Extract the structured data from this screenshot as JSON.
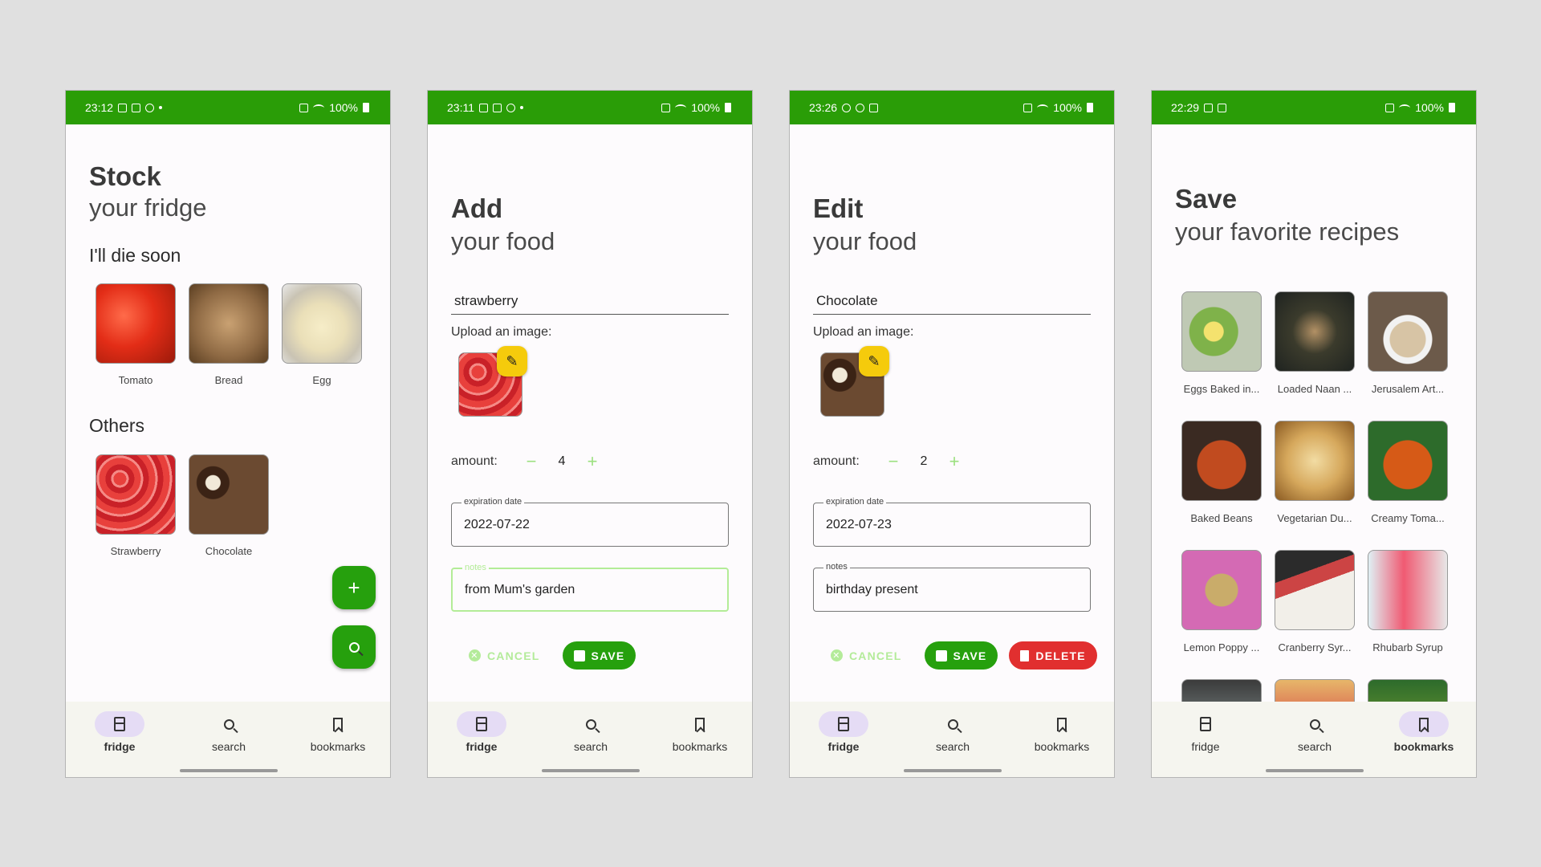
{
  "colors": {
    "primary": "#26a00d",
    "status_bar": "#2a9d07",
    "edit_badge": "#f5cb0c",
    "delete": "#e12f2f",
    "cancel": "#b4eb9a"
  },
  "nav": {
    "fridge": "fridge",
    "search": "search",
    "bookmarks": "bookmarks"
  },
  "screens": [
    {
      "status": {
        "time": "23:12",
        "battery": "100%"
      },
      "title_bold": "Stock",
      "title_light": "your fridge",
      "sections": [
        {
          "title": "I'll die soon",
          "items": [
            {
              "label": "Tomato",
              "image": "tomato"
            },
            {
              "label": "Bread",
              "image": "bread"
            },
            {
              "label": "Egg",
              "image": "egg"
            }
          ]
        },
        {
          "title": "Others",
          "items": [
            {
              "label": "Strawberry",
              "image": "strawberry"
            },
            {
              "label": "Chocolate",
              "image": "chocolate"
            }
          ]
        }
      ],
      "fabs": {
        "add": "+",
        "search": "search-icon"
      }
    },
    {
      "status": {
        "time": "23:11",
        "battery": "100%"
      },
      "title_bold": "Add",
      "title_light": "your food",
      "name": "strawberry",
      "upload_label": "Upload an image:",
      "amount_label": "amount:",
      "amount": "4",
      "expiration_label": "expiration date",
      "expiration_value": "2022-07-22",
      "notes_label": "notes",
      "notes_value": "from Mum's garden",
      "cancel": "CANCEL",
      "save": "SAVE"
    },
    {
      "status": {
        "time": "23:26",
        "battery": "100%"
      },
      "title_bold": "Edit",
      "title_light": "your food",
      "name": "Chocolate",
      "upload_label": "Upload an image:",
      "amount_label": "amount:",
      "amount": "2",
      "expiration_label": "expiration date",
      "expiration_value": "2022-07-23",
      "notes_label": "notes",
      "notes_value": "birthday present",
      "cancel": "CANCEL",
      "save": "SAVE",
      "delete": "DELETE"
    },
    {
      "status": {
        "time": "22:29",
        "battery": "100%"
      },
      "title_bold": "Save",
      "title_light": "your favorite recipes",
      "recipes": [
        {
          "label": "Eggs Baked in...",
          "image": "avo"
        },
        {
          "label": "Loaded Naan ...",
          "image": "naan"
        },
        {
          "label": "Jerusalem Art...",
          "image": "soup1"
        },
        {
          "label": "Baked Beans",
          "image": "beans"
        },
        {
          "label": "Vegetarian Du...",
          "image": "dumpl"
        },
        {
          "label": "Creamy Toma...",
          "image": "soup2"
        },
        {
          "label": "Lemon Poppy ...",
          "image": "muffin"
        },
        {
          "label": "Cranberry Syr...",
          "image": "cran"
        },
        {
          "label": "Rhubarb Syrup",
          "image": "rhub"
        }
      ]
    }
  ]
}
